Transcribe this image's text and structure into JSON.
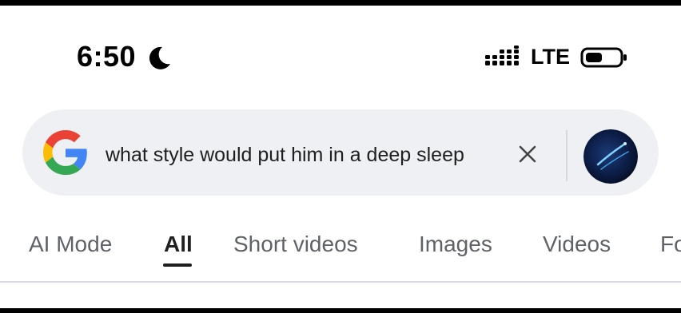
{
  "status_bar": {
    "time": "6:50",
    "network": "LTE",
    "icons": [
      "moon-icon",
      "signal-icon",
      "battery-icon"
    ]
  },
  "search": {
    "logo": "google-g-logo",
    "query": "what style would put him in a deep sleep",
    "clear_icon": "close-icon",
    "avatar": "profile-avatar"
  },
  "tabs": [
    {
      "label": "AI Mode",
      "active": false
    },
    {
      "label": "All",
      "active": true
    },
    {
      "label": "Short videos",
      "active": false
    },
    {
      "label": "Images",
      "active": false
    },
    {
      "label": "Videos",
      "active": false
    },
    {
      "label": "Fo",
      "active": false
    }
  ],
  "colors": {
    "search_bg": "#eef0f3",
    "active_tab": "#1f1f1f",
    "inactive_tab": "#5f6368",
    "google_blue": "#4285F4",
    "google_red": "#EA4335",
    "google_yellow": "#FBBC05",
    "google_green": "#34A853"
  }
}
